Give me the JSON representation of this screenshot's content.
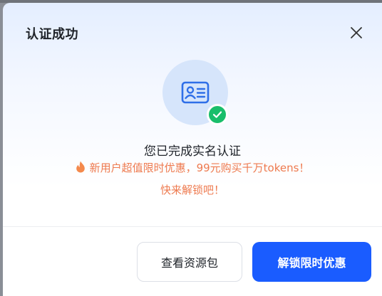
{
  "dialog": {
    "title": "认证成功",
    "message": "您已完成实名认证",
    "promo_line1": "新用户超值限时优惠，99元购买千万tokens！",
    "promo_line2": "快来解锁吧！",
    "buttons": {
      "secondary_label": "查看资源包",
      "primary_label": "解锁限时优惠"
    }
  },
  "icons": {
    "close": "close-icon",
    "id_card": "id-card-icon",
    "check": "check-icon",
    "flame": "flame-icon"
  },
  "colors": {
    "primary": "#1a5cff",
    "success": "#19be6b",
    "promo": "#ee7a4f",
    "hero_bg": "#d6e5fb"
  }
}
